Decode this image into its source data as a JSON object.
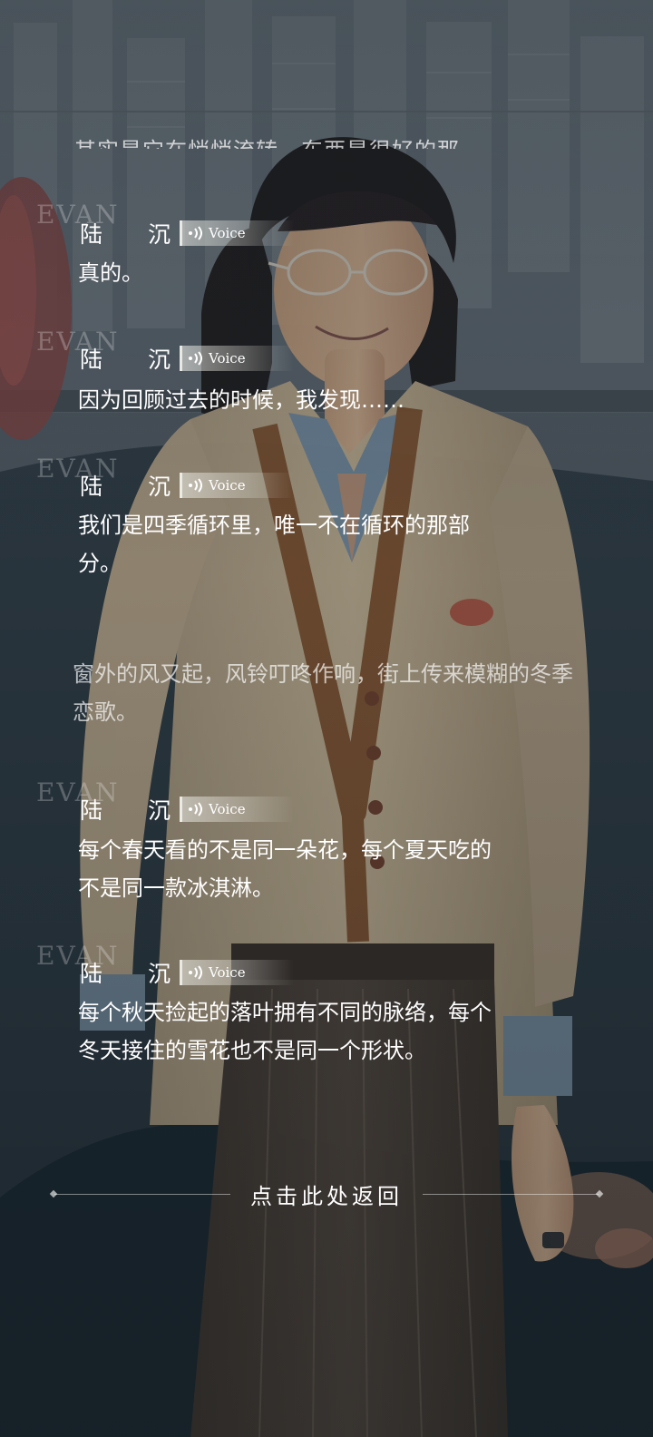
{
  "watermark_text": "EVAN",
  "backlog": {
    "cut_off_text": "其实是它在悄悄流转，东西是很好的那",
    "entries": [
      {
        "speaker": "陆沉",
        "voice_label": "Voice",
        "text": "真的。"
      },
      {
        "speaker": "陆沉",
        "voice_label": "Voice",
        "text": "因为回顾过去的时候，我发现……"
      },
      {
        "speaker": "陆沉",
        "voice_label": "Voice",
        "text": "我们是四季循环里，唯一不在循环的那部分。"
      },
      {
        "narration": "窗外的风又起，风铃叮咚作响，街上传来模糊的冬季恋歌。"
      },
      {
        "speaker": "陆沉",
        "voice_label": "Voice",
        "text": "每个春天看的不是同一朵花，每个夏天吃的不是同一款冰淇淋。"
      },
      {
        "speaker": "陆沉",
        "voice_label": "Voice",
        "text": "每个秋天捡起的落叶拥有不同的脉络，每个冬天接住的雪花也不是同一个形状。"
      }
    ]
  },
  "return_button_label": "点击此处返回",
  "icons": {
    "voice": "speaker-waves-icon",
    "divider_ornament": "diamond-icon"
  },
  "colors": {
    "text_primary": "#ffffff",
    "narration_text": "#b9bcbf",
    "watermark": "#9ba3aa",
    "voice_tag_bg": "#d8d6cf"
  }
}
